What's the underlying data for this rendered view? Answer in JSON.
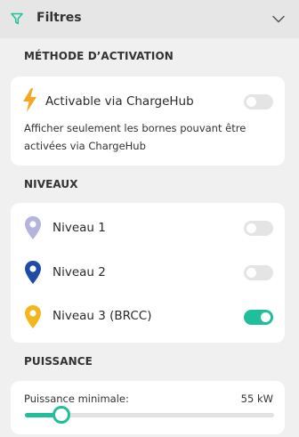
{
  "header": {
    "title": "Filtres",
    "filter_icon": "filter-funnel-icon",
    "chevron_icon": "chevron-down-icon",
    "accent_color": "#1fbf9a"
  },
  "activation": {
    "section_title": "MÉTHODE D’ACTIVATION",
    "label": "Activable via ChargeHub",
    "description_line1": "Afficher seulement les bornes pouvant être",
    "description_line2": "activées via ChargeHub",
    "icon": "lightning-bolt-icon",
    "enabled": false
  },
  "levels": {
    "section_title": "NIVEAUX",
    "items": [
      {
        "label": "Niveau 1",
        "pin_color": "#b4b4dc",
        "enabled": false
      },
      {
        "label": "Niveau 2",
        "pin_color": "#1f4aa5",
        "enabled": false
      },
      {
        "label": "Niveau 3 (BRCC)",
        "pin_color": "#f2b71c",
        "enabled": true
      }
    ]
  },
  "power": {
    "section_title": "PUISSANCE",
    "min_label": "Puissance minimale:",
    "value_label": "55 kW",
    "slider_fraction": 0.15
  }
}
